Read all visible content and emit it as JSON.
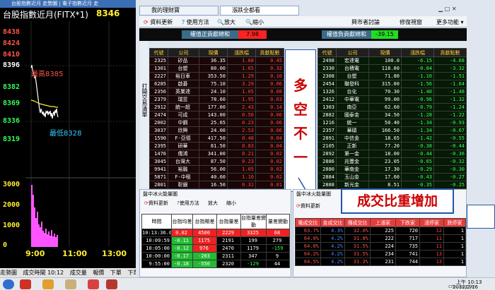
{
  "left_panel": {
    "title_strip": "台股指數近月 走勢圖  | 電子指數近月 走",
    "chart_title": "台股指數近月(FITX*1)",
    "current_price": "8346",
    "y_labels": [
      "8438",
      "8424",
      "8410",
      "8396",
      "8382",
      "8369",
      "8336",
      "8319",
      "3000",
      "2000",
      "1000",
      "0"
    ],
    "high_label": "最高8385",
    "low_label": "最低8328",
    "time_labels": [
      "9:00",
      "11:00",
      "13:00"
    ],
    "bottom_tabs": [
      "走勢圖",
      "成交時間 10:12",
      "成交量",
      "報價",
      "下單",
      "下單"
    ]
  },
  "window": {
    "tabs": [
      "我的理財寶",
      "漲跌全都看"
    ],
    "toolbar": {
      "refresh": "資料更新",
      "help": "使用方法",
      "zoom_in": "放大",
      "zoom_out": "縮小",
      "discuss": "興市者討論",
      "fix_window": "修復視窗",
      "more": "更多功能"
    },
    "summary": {
      "pos_label": "權值正貢獻總和",
      "pos_value": "7.98",
      "neg_label": "權值負貢獻總和",
      "neg_value": "-39.15"
    },
    "side_tab": "打開交易清單",
    "columns": [
      "代號",
      "公司",
      "現價",
      "漲跌幅",
      "貢獻點數"
    ],
    "left_rows": [
      [
        "2325",
        "矽品",
        "36.35",
        "1.68",
        "0.45"
      ],
      [
        "1301",
        "台塑",
        "80.00",
        "1.65",
        "0.32"
      ],
      [
        "2227",
        "裕日車",
        "353.50",
        "1.29",
        "0.10"
      ],
      [
        "6285",
        "啟碁",
        "75.10",
        "3.29",
        "0.06"
      ],
      [
        "2356",
        "英業達",
        "24.10",
        "1.05",
        "0.08"
      ],
      [
        "2379",
        "瑞昱",
        "78.60",
        "1.95",
        "0.03"
      ],
      [
        "2912",
        "統一超",
        "177.00",
        "2.43",
        "0.14"
      ],
      [
        "2474",
        "可成",
        "143.00",
        "0.56",
        "0.06"
      ],
      [
        "2002",
        "中鋼",
        "25.65",
        "0.23",
        "0.06"
      ],
      [
        "3037",
        "欣興",
        "24.00",
        "2.53",
        "0.06"
      ],
      [
        "1590",
        "F-亞德",
        "417.50",
        "0.48",
        "0.04"
      ],
      [
        "2395",
        "研華",
        "81.50",
        "0.83",
        "0.04"
      ],
      [
        "1476",
        "儒鴻",
        "341.00",
        "0.21",
        "0.02"
      ],
      [
        "3045",
        "台灣大",
        "87.50",
        "0.23",
        "0.02"
      ],
      [
        "9941",
        "裕融",
        "56.00",
        "1.05",
        "0.02"
      ],
      [
        "5871",
        "F-中租",
        "40.60",
        "1.10",
        "0.02"
      ],
      [
        "2801",
        "彰銀",
        "16.50",
        "0.31",
        "0.01"
      ],
      [
        "2883",
        "開發",
        "8.22",
        "0.12",
        "0.01"
      ]
    ],
    "right_rows": [
      [
        "2498",
        "宏達電",
        "100.0",
        "-6.15",
        "-4.68"
      ],
      [
        "2330",
        "台積電",
        "118.00",
        "-0.84",
        "-3.32"
      ],
      [
        "2308",
        "台塑",
        "71.80",
        "-1.10",
        "-1.51"
      ],
      [
        "2454",
        "聯發科",
        "315.00",
        "-1.56",
        "-1.64"
      ],
      [
        "1326",
        "台化",
        "70.30",
        "-1.40",
        "-1.48"
      ],
      [
        "2412",
        "中華電",
        "99.00",
        "-0.96",
        "-1.32"
      ],
      [
        "1303",
        "南亞",
        "62.60",
        "-0.79",
        "-1.24"
      ],
      [
        "2882",
        "國泰金",
        "34.50",
        "-1.28",
        "-1.22"
      ],
      [
        "1216",
        "統一",
        "50.40",
        "-1.34",
        "-0.93"
      ],
      [
        "2357",
        "華碩",
        "166.50",
        "-1.34",
        "-0.67"
      ],
      [
        "2891",
        "中信金",
        "18.65",
        "-1.42",
        "-0.55"
      ],
      [
        "2105",
        "正新",
        "77.20",
        "-0.38",
        "-0.44"
      ],
      [
        "2892",
        "第一金",
        "18.00",
        "-0.44",
        "-0.36"
      ],
      [
        "2886",
        "兆豐金",
        "23.05",
        "-0.65",
        "-0.32"
      ],
      [
        "2880",
        "華南金",
        "17.30",
        "-0.29",
        "-0.30"
      ],
      [
        "2884",
        "玉山金",
        "17.60",
        "-0.43",
        "-0.27"
      ],
      [
        "2888",
        "新光金",
        "8.51",
        "-0.35",
        "-0.25"
      ],
      [
        "2885",
        "元大金",
        "14.15",
        "-0.35",
        "-0.22"
      ]
    ],
    "annotation": [
      "多",
      "空",
      "不",
      "一"
    ]
  },
  "lower_left": {
    "title": "盤中冰火能量圖",
    "refresh": "資料更新",
    "help": "使用方法",
    "zoom_in": "放大",
    "zoom_out": "縮小",
    "columns": [
      "時間",
      "台指均差",
      "台指期差",
      "台指量差",
      "台指量差變動",
      "量差變動"
    ],
    "rows": [
      [
        "10:13:36.07",
        "0.02",
        "4500",
        "2229",
        "3325",
        "68"
      ],
      [
        "10:09:59",
        "-0.11",
        "1175",
        "2191",
        "199",
        "279"
      ],
      [
        "10:05:00",
        "-0.12",
        "976",
        "2470",
        "1179",
        "-159"
      ],
      [
        "10:00:00",
        "-0.17",
        "-203",
        "2311",
        "347",
        "9"
      ],
      [
        "9:55:00",
        "-0.18",
        "-550",
        "2320",
        "-129",
        "44"
      ]
    ]
  },
  "lower_right": {
    "title": "盤中冰火能量圖",
    "refresh": "資料更新",
    "callout": "成交比重增加",
    "columns": [
      "電成交比",
      "金成交比",
      "傳成交比",
      "上漲家",
      "下跌家",
      "漲停家",
      "跌停家"
    ],
    "rows": [
      [
        "63.7%",
        "4.3%",
        "32.0%",
        "225",
        "720",
        "12",
        "1"
      ],
      [
        "64.0%",
        "4.2%",
        "31.8%",
        "222",
        "717",
        "11",
        "1"
      ],
      [
        "64.0%",
        "4.2%",
        "31.5%",
        "224",
        "735",
        "11",
        "1"
      ],
      [
        "64.2%",
        "4.2%",
        "31.5%",
        "234",
        "741",
        "13",
        "1"
      ],
      [
        "64.5%",
        "4.2%",
        "31.3%",
        "231",
        "744",
        "13",
        "1"
      ]
    ]
  },
  "taskbar": {
    "time": "上午 10:13",
    "date": "2012/2/16",
    "watermark": "cmoney.tw"
  }
}
